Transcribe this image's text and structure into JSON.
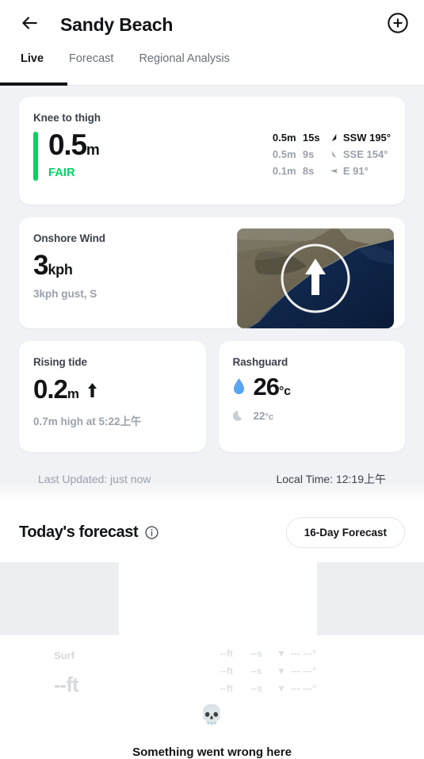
{
  "header": {
    "title": "Sandy Beach",
    "back_icon": "arrow-left-icon",
    "add_icon": "plus-circle-icon"
  },
  "tabs": [
    {
      "label": "Live",
      "active": true
    },
    {
      "label": "Forecast",
      "active": false
    },
    {
      "label": "Regional Analysis",
      "active": false
    }
  ],
  "surf": {
    "label": "Knee to thigh",
    "height": "0.5",
    "unit": "m",
    "rating": "FAIR",
    "rating_color": "#00D464",
    "swells": [
      {
        "height": "0.5m",
        "period": "15s",
        "direction": "SSW 195°",
        "arrow": "swell-arrow-ssw",
        "primary": true
      },
      {
        "height": "0.5m",
        "period": "9s",
        "direction": "SSE 154°",
        "arrow": "swell-arrow-sse",
        "primary": false
      },
      {
        "height": "0.1m",
        "period": "8s",
        "direction": "E 91°",
        "arrow": "swell-arrow-e",
        "primary": false
      }
    ]
  },
  "wind": {
    "label": "Onshore Wind",
    "speed": "3",
    "unit": "kph",
    "sub": "3kph gust, S",
    "map_icon": "wind-direction-map",
    "arrow_icon": "wind-arrow-up-icon"
  },
  "tide": {
    "label": "Rising tide",
    "value": "0.2",
    "unit": "m",
    "arrow": "⬆",
    "arrow_icon": "tide-rising-arrow-icon",
    "sub": "0.7m high at 5:22上午"
  },
  "rashguard": {
    "label": "Rashguard",
    "water_temp": "26",
    "water_unit": "°c",
    "air_temp": "22",
    "air_unit": "°c",
    "water_icon": "water-drop-icon",
    "air_icon": "moon-icon"
  },
  "status": {
    "last_updated": "Last Updated: just now",
    "local_time": "Local Time: 12:19上午"
  },
  "forecast": {
    "title": "Today's forecast",
    "info_icon": "info-circle-icon",
    "pill_label": "16-Day Forecast"
  },
  "error_zone": {
    "surf_label": "Surf",
    "surf_placeholder": "--ft",
    "skull_icon": "skull-icon",
    "message": "Something went wrong here",
    "ghost_rows": [
      {
        "height": "--ft",
        "period": "--s",
        "arrow": "▼",
        "direction": "--- ---°"
      },
      {
        "height": "--ft",
        "period": "--s",
        "arrow": "▼",
        "direction": "--- ---°"
      },
      {
        "height": "--ft",
        "period": "--s",
        "arrow": "▼",
        "direction": "--- ---°"
      }
    ]
  },
  "colors": {
    "page_bg": "#f1f2f5",
    "card_bg": "#ffffff",
    "accent_green": "#00D464",
    "muted": "#9aa1ab",
    "skeleton": "#eceef2"
  }
}
